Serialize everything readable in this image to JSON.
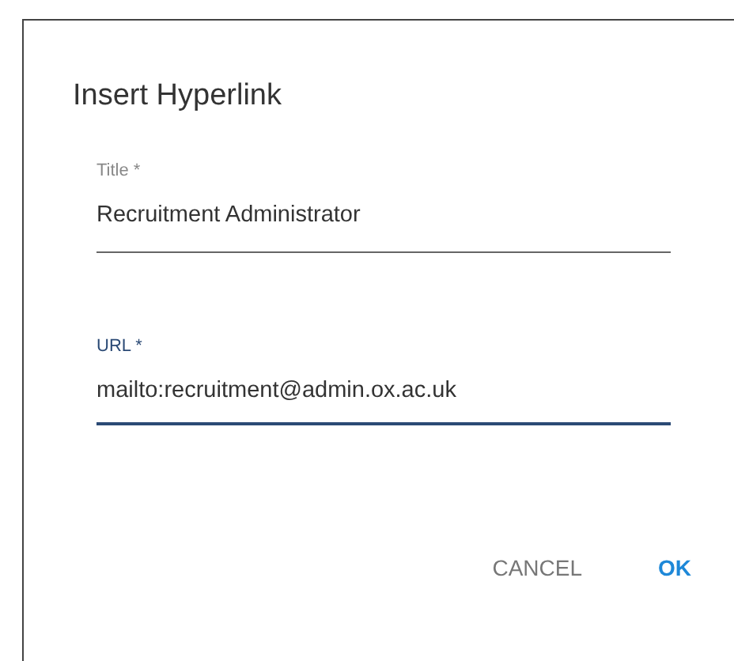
{
  "dialog": {
    "title": "Insert Hyperlink",
    "fields": [
      {
        "label": "Title *",
        "value": "Recruitment Administrator",
        "focused": false
      },
      {
        "label": "URL *",
        "value": "mailto:recruitment@admin.ox.ac.uk",
        "focused": true
      }
    ],
    "buttons": [
      {
        "label": "CANCEL",
        "primary": false
      },
      {
        "label": "OK",
        "primary": true
      }
    ]
  }
}
